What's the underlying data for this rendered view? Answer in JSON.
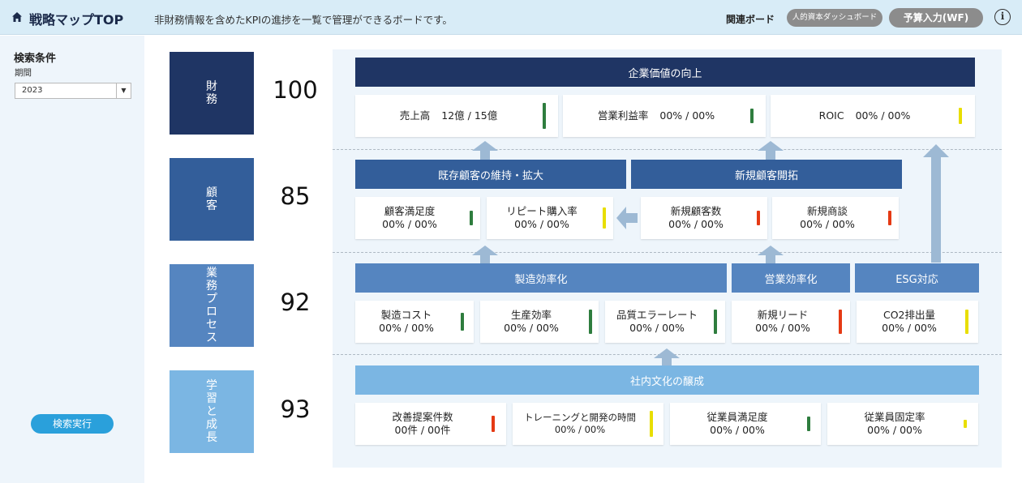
{
  "header": {
    "title": "戦略マップTOP",
    "description": "非財務情報を含めたKPIの進捗を一覧で管理ができるボードです。",
    "related_label": "関連ボード",
    "related_buttons": [
      "人的資本ダッシュボード",
      "予算入力(WF)"
    ],
    "info_symbol": "i"
  },
  "sidebar": {
    "title": "検索条件",
    "period_label": "期間",
    "period_value": "2023",
    "search_button": "検索実行"
  },
  "perspectives": [
    {
      "label": "財務",
      "score": "100",
      "color": "#1f3564"
    },
    {
      "label": "顧客",
      "score": "85",
      "color": "#335e9a"
    },
    {
      "label": "業務プロセス",
      "score": "92",
      "color": "#5585c0"
    },
    {
      "label": "学習と成長",
      "score": "93",
      "color": "#7bb6e3"
    }
  ],
  "bands": {
    "financial": "企業価値の向上",
    "existing_customers": "既存顧客の維持・拡大",
    "new_customers": "新規顧客開拓",
    "manufacturing": "製造効率化",
    "sales": "営業効率化",
    "esg": "ESG対応",
    "culture": "社内文化の醸成"
  },
  "kpis": {
    "financial": [
      {
        "label": "売上高",
        "value": "12億 / 15億",
        "status": "green",
        "level": 0.8
      },
      {
        "label": "営業利益率",
        "value": "00% / 00%",
        "status": "green",
        "level": 0.45
      },
      {
        "label": "ROIC",
        "value": "00% / 00%",
        "status": "yellow",
        "level": 0.5
      }
    ],
    "customer": [
      {
        "label": "顧客満足度",
        "value": "00% / 00%",
        "status": "green",
        "level": 0.45
      },
      {
        "label": "リピート購入率",
        "value": "00% / 00%",
        "status": "yellow",
        "level": 0.65
      },
      {
        "label": "新規顧客数",
        "value": "00% / 00%",
        "status": "red",
        "level": 0.45
      },
      {
        "label": "新規商談",
        "value": "00% / 00%",
        "status": "red",
        "level": 0.45
      }
    ],
    "process": [
      {
        "label": "製造コスト",
        "value": "00% / 00%",
        "status": "green",
        "level": 0.55
      },
      {
        "label": "生産効率",
        "value": "00% / 00%",
        "status": "green",
        "level": 0.75
      },
      {
        "label": "品質エラーレート",
        "value": "00% / 00%",
        "status": "green",
        "level": 0.75
      },
      {
        "label": "新規リード",
        "value": "00% / 00%",
        "status": "red",
        "level": 0.75
      },
      {
        "label": "CO2排出量",
        "value": "00% / 00%",
        "status": "yellow",
        "level": 0.75
      }
    ],
    "learning": [
      {
        "label": "改善提案件数",
        "value": "00件 / 00件",
        "status": "red",
        "level": 0.5
      },
      {
        "label": "トレーニングと開発の時間",
        "value": "00% / 00%",
        "status": "yellow",
        "level": 0.8
      },
      {
        "label": "従業員満足度",
        "value": "00% / 00%",
        "status": "green",
        "level": 0.45
      },
      {
        "label": "従業員固定率",
        "value": "00% / 00%",
        "status": "yellow",
        "level": 0.25
      }
    ]
  },
  "colors": {
    "green": "#2e7d3e",
    "yellow": "#e8de00",
    "red": "#e53a14",
    "band_dark": "#1f3564",
    "band_mid": "#335e9a",
    "band_process": "#5585c0",
    "band_learning": "#7bb6e3",
    "arrow": "#9db9d4"
  }
}
